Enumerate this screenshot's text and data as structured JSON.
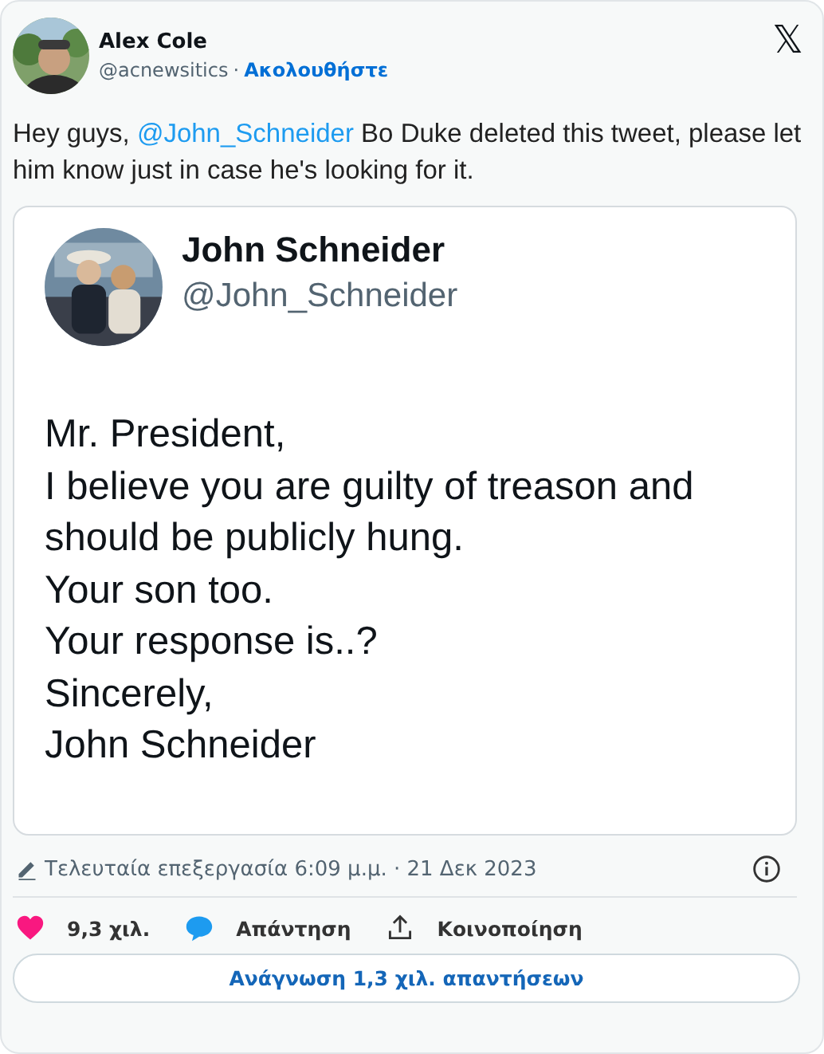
{
  "author": {
    "name": "Alex Cole",
    "handle": "@acnewsitics",
    "separator": "·",
    "follow": "Ακολουθήστε"
  },
  "logo": "𝕏",
  "tweet": {
    "before": "Hey guys, ",
    "mention": "@John_Schneider",
    "after": " Bo Duke deleted this tweet, please let him know just in case he's looking for it."
  },
  "quoted": {
    "name": "John Schneider",
    "handle": "@John_Schneider",
    "lines": [
      "Mr. President,",
      "I believe you are guilty of treason and",
      "should be publicly hung.",
      "Your son too.",
      "Your response is..?",
      "Sincerely,",
      "John Schneider"
    ]
  },
  "edited": "Τελευταία επεξεργασία 6:09 μ.μ. · 21 Δεκ 2023",
  "actions": [
    {
      "kind": "like",
      "label": "9,3 χιλ."
    },
    {
      "kind": "reply",
      "label": "Απάντηση"
    },
    {
      "kind": "share",
      "label": "Κοινοποίηση"
    }
  ],
  "read_replies": "Ανάγνωση 1,3 χιλ. απαντήσεων"
}
